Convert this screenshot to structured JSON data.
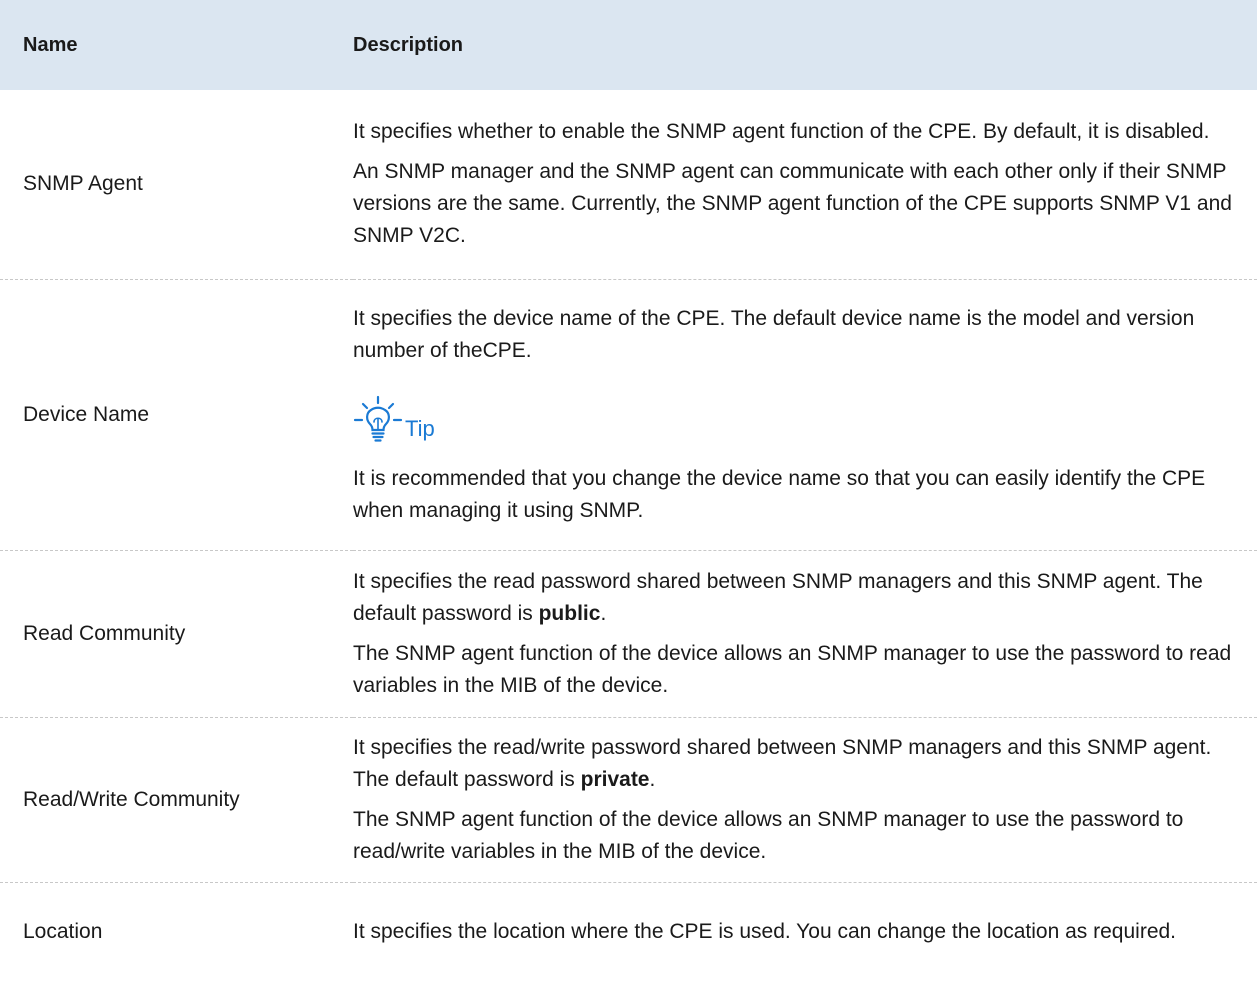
{
  "table": {
    "headers": {
      "name": "Name",
      "description": "Description"
    },
    "rows": [
      {
        "name": "SNMP Agent",
        "paragraphs": [
          {
            "pre": "It specifies whether to enable the SNMP agent function of the CPE. By default, it is disabled."
          },
          {
            "pre": "An SNMP manager and the SNMP agent can communicate with each other only if their SNMP versions are the same. Currently, the SNMP agent function of the CPE supports SNMP V1 and SNMP V2C."
          }
        ]
      },
      {
        "name": "Device Name",
        "paragraphs": [
          {
            "pre": "It specifies the device name of the CPE. The default device name is the model and version number of theCPE."
          }
        ],
        "tip": {
          "icon": "lightbulb-icon",
          "label": "Tip",
          "text": "It is recommended that you change the device name so that you can easily identify the CPE when managing it using SNMP."
        }
      },
      {
        "name": "Read Community",
        "paragraphs": [
          {
            "pre": "It specifies the read password shared between SNMP managers and this SNMP agent. The default password is ",
            "bold": "public",
            "post": "."
          },
          {
            "pre": "The SNMP agent function of the device allows an SNMP manager to use the password to read variables in the MIB of the device."
          }
        ]
      },
      {
        "name": "Read/Write Community",
        "paragraphs": [
          {
            "pre": "It specifies the read/write password shared between SNMP managers and this SNMP agent. The default password is ",
            "bold": "private",
            "post": "."
          },
          {
            "pre": "The SNMP agent function of the device allows an SNMP manager to use the password to read/write variables in the MIB of the device."
          }
        ]
      },
      {
        "name": "Location",
        "paragraphs": [
          {
            "pre": "It specifies the location where the CPE is used. You can change the location as required."
          }
        ]
      }
    ]
  },
  "colors": {
    "header_bg": "#dbe6f1",
    "tip_accent": "#1a7ad4",
    "row_divider": "#c8c8c8"
  }
}
